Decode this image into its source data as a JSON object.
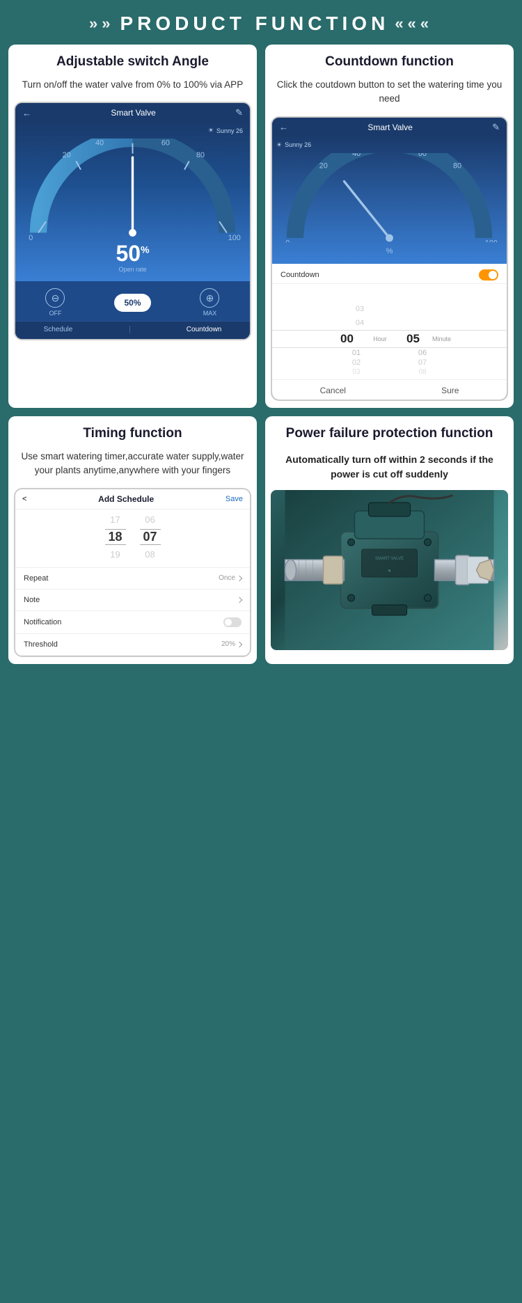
{
  "header": {
    "title": "PRODUCT FUNCTION",
    "left_arrows": "»»",
    "right_arrows": "«««"
  },
  "card1": {
    "title": "Adjustable switch Angle",
    "desc": "Turn on/off the water valve from 0% to 100% via APP",
    "phone": {
      "header_title": "Smart Valve",
      "weather": "Sunny 26",
      "gauge_labels": [
        "0",
        "20",
        "40",
        "60",
        "80",
        "100"
      ],
      "gauge_value": "50",
      "gauge_unit": "%",
      "gauge_sub": "Open rate",
      "btn_off": "OFF",
      "btn_max": "MAX",
      "btn_value": "50%",
      "tab1": "Schedule",
      "tab2": "Countdown"
    }
  },
  "card2": {
    "title": "Countdown function",
    "desc": "Click the coutdown button to set the watering time you need",
    "phone": {
      "header_title": "Smart Valve",
      "weather": "Sunny 26",
      "gauge_value": "",
      "gauge_unit": "%",
      "countdown_label": "Countdown",
      "hour_label": "Hour",
      "minute_label": "Minute",
      "col1_vals": [
        "",
        "03",
        "04",
        "00",
        "01",
        "02",
        "03"
      ],
      "col2_vals": [
        "",
        "",
        "",
        "05",
        "06",
        "07",
        "08"
      ],
      "cancel": "Cancel",
      "sure": "Sure"
    }
  },
  "card3": {
    "title": "Timing function",
    "desc": "Use smart watering timer,accurate water supply,water your plants anytime,anywhere with your fingers",
    "phone": {
      "header_title": "Add Schedule",
      "back": "<",
      "save": "Save",
      "time_prev": [
        "17",
        "06"
      ],
      "time_main": [
        "18",
        "07"
      ],
      "time_next": [
        "19",
        "08"
      ],
      "repeat_label": "Repeat",
      "repeat_val": "Once",
      "note_label": "Note",
      "notification_label": "Notification",
      "threshold_label": "Threshold",
      "threshold_val": "20%"
    }
  },
  "card4": {
    "title": "Power failure protection function",
    "desc": "Automatically turn off within 2 seconds if the power is cut off suddenly"
  },
  "repeat_once": "Repeat Once"
}
